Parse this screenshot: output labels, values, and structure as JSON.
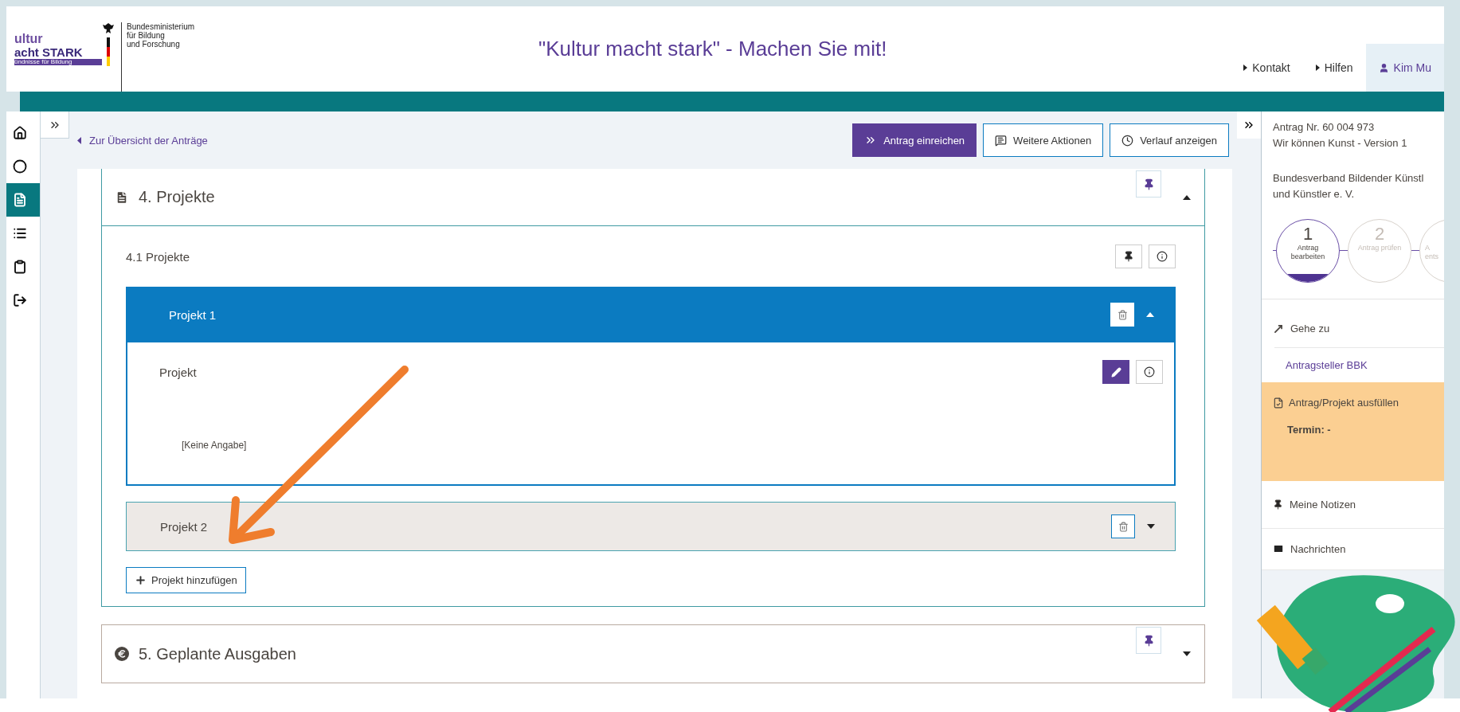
{
  "header": {
    "logo_lines": [
      "ultur",
      "acht STARK",
      "ündnisse für Bildung"
    ],
    "ministry_lines": [
      "Bundesministerium",
      "für Bildung",
      "und Forschung"
    ],
    "title": "\"Kultur macht stark\" - Machen Sie mit!",
    "nav": [
      {
        "label": "Kontakt",
        "kind": "link",
        "selected": false
      },
      {
        "label": "Hilfen",
        "kind": "link",
        "selected": false
      },
      {
        "label": "Kim Mu",
        "kind": "user",
        "selected": true
      }
    ]
  },
  "sidebar_icons": [
    {
      "kind": "home",
      "selected": false
    },
    {
      "kind": "circle",
      "selected": false
    },
    {
      "kind": "file",
      "selected": true
    },
    {
      "kind": "list",
      "selected": false
    },
    {
      "kind": "clipboard",
      "selected": false
    },
    {
      "kind": "exit",
      "selected": false
    }
  ],
  "toolbar": {
    "back_link": "Zur Übersicht der Anträge",
    "buttons": [
      {
        "label": "Antrag einreichen",
        "kind": "primary"
      },
      {
        "label": "Weitere Aktionen",
        "kind": "actions"
      },
      {
        "label": "Verlauf anzeigen",
        "kind": "history"
      }
    ]
  },
  "sections": [
    {
      "title": "4. Projekte",
      "kind": "document",
      "expanded": true,
      "subsection": {
        "title": "4.1 Projekte",
        "projects": [
          {
            "title": "Projekt 1",
            "expanded": true,
            "fields": [
              {
                "label": "Projekt",
                "value": "[Keine Angabe]"
              }
            ]
          },
          {
            "title": "Projekt 2",
            "expanded": false
          }
        ],
        "add_button": "Projekt hinzufügen"
      }
    },
    {
      "title": "5. Geplante Ausgaben",
      "kind": "euro",
      "expanded": false
    }
  ],
  "right_panel": {
    "application_lines": [
      "Antrag Nr. 60 004 973",
      "Wir können Kunst - Version 1"
    ],
    "organisation_lines": [
      "Bundesverband Bildender Künstl",
      "und Künstler e. V."
    ],
    "steps": [
      {
        "number": "1",
        "label_lines": [
          "Antrag",
          "bearbeiten"
        ],
        "selected": true
      },
      {
        "number": "2",
        "label_lines": [
          "Antrag prüfen"
        ],
        "selected": false
      },
      {
        "label_lines": [
          "A",
          "ents"
        ],
        "selected": false
      }
    ],
    "goto": {
      "title": "Gehe zu",
      "link": "Antragsteller BBK"
    },
    "task": {
      "title": "Antrag/Projekt ausfüllen",
      "deadline": "Termin: -"
    },
    "notes": "Meine Notizen",
    "messages": "Nachrichten"
  }
}
